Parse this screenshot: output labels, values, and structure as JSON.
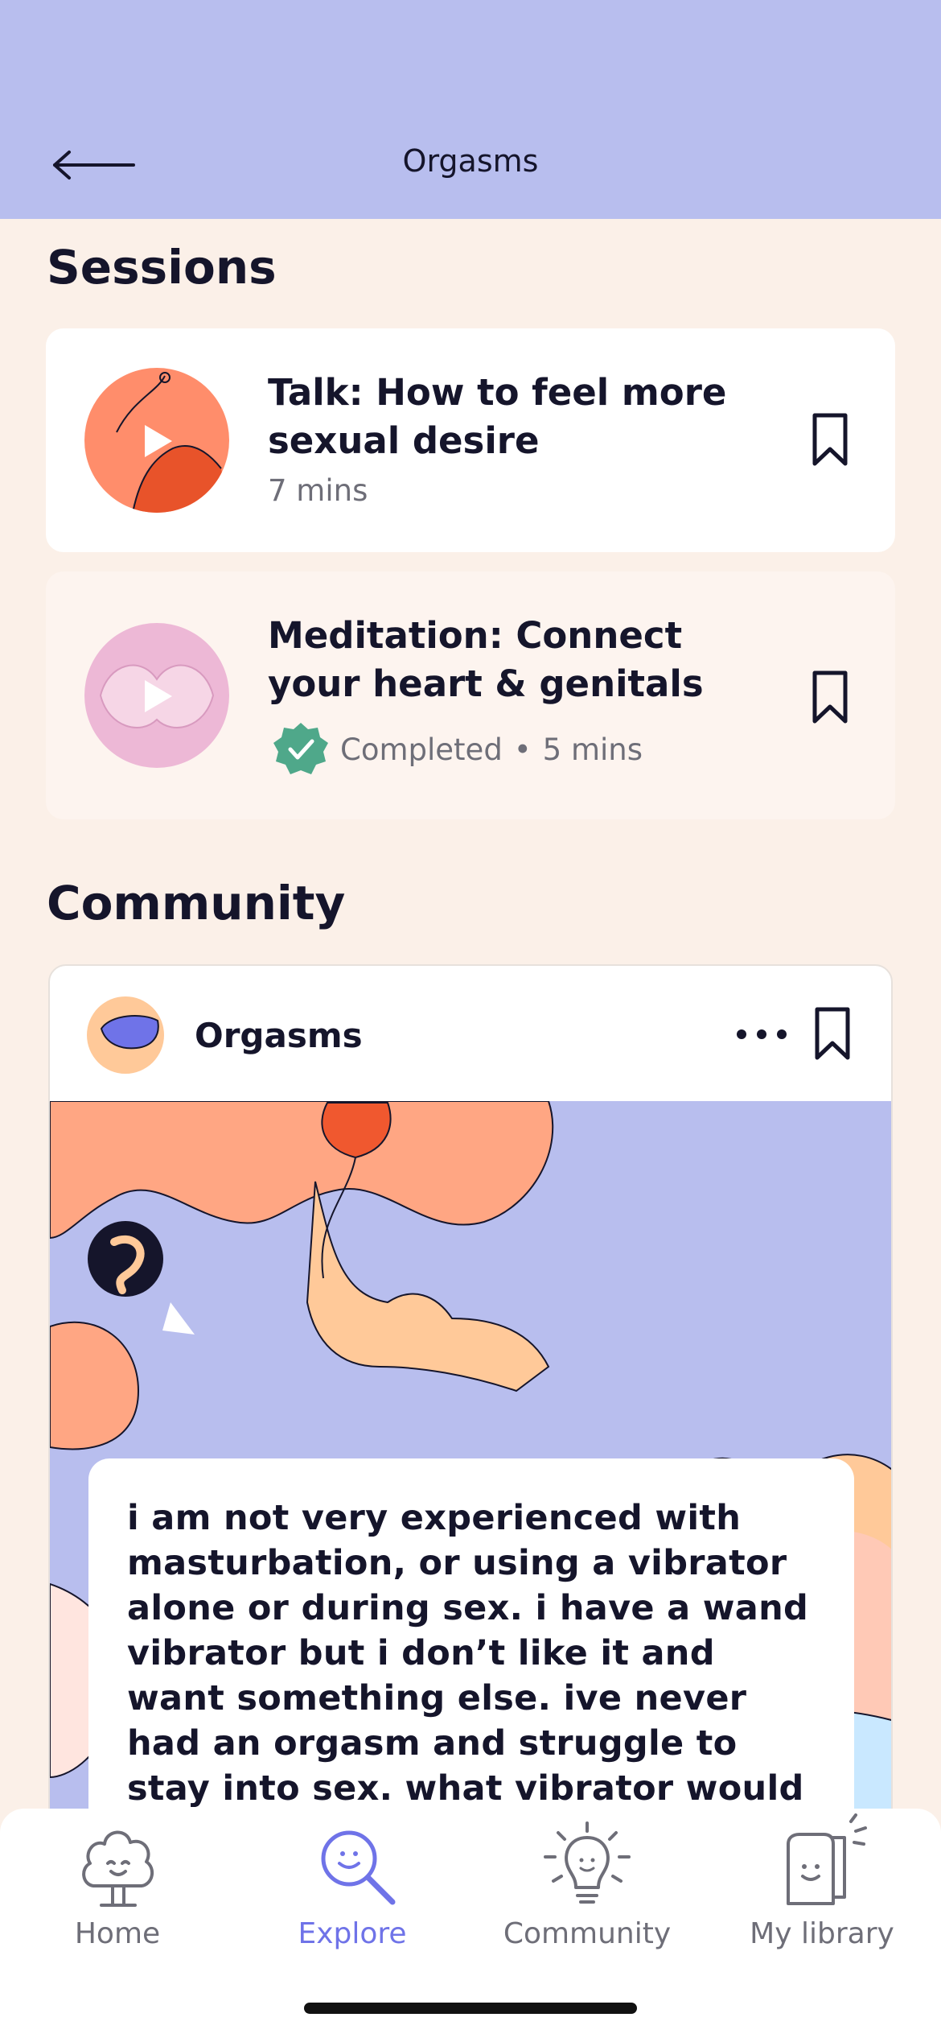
{
  "header": {
    "title": "Orgasms",
    "back_icon": "arrow-left-icon"
  },
  "sessions": {
    "heading": "Sessions",
    "items": [
      {
        "title_line1": "Talk: How to feel more",
        "title_line2": "sexual desire",
        "duration": "7 mins",
        "completed": false
      },
      {
        "title_line1": "Meditation: Connect",
        "title_line2": "your heart & genitals",
        "status": "Completed",
        "separator": "•",
        "duration": "5 mins",
        "completed": true
      }
    ]
  },
  "community": {
    "heading": "Community",
    "post": {
      "group": "Orgasms",
      "text": "i am not very experienced with masturbation, or using a vibrator alone or during sex. i have a wand vibrator but i don’t like it and want something else. ive never had an orgasm and struggle to stay into sex. what vibrator would you recommend?"
    }
  },
  "tabs": [
    {
      "label": "Home",
      "icon": "home-icon",
      "active": false
    },
    {
      "label": "Explore",
      "icon": "explore-icon",
      "active": true
    },
    {
      "label": "Community",
      "icon": "lightbulb-icon",
      "active": false
    },
    {
      "label": "My library",
      "icon": "library-icon",
      "active": false
    }
  ],
  "colors": {
    "header_bg": "#B8BEEE",
    "page_bg": "#FBF0E8",
    "accent": "#6F73E8",
    "text": "#15152B",
    "muted": "#6E6E78",
    "completed_badge": "#4FA88A"
  }
}
